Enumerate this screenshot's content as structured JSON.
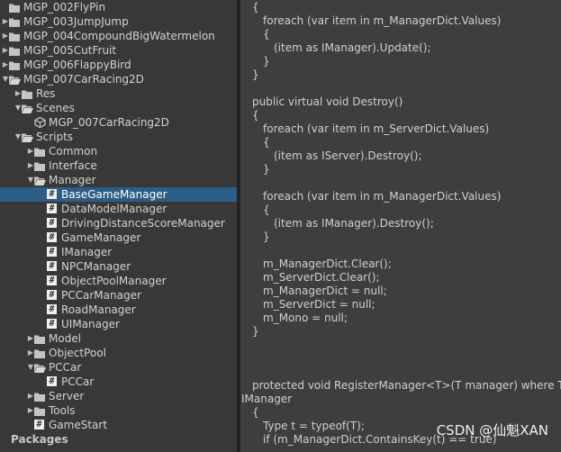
{
  "project_tree": {
    "items": [
      {
        "label": "MGP_002FlyPin",
        "depth": 0,
        "icon": "folder-icon",
        "expander": "none",
        "selected": false
      },
      {
        "label": "MGP_003JumpJump",
        "depth": 0,
        "icon": "folder-icon",
        "expander": "collapsed",
        "selected": false
      },
      {
        "label": "MGP_004CompoundBigWatermelon",
        "depth": 0,
        "icon": "folder-icon",
        "expander": "collapsed",
        "selected": false
      },
      {
        "label": "MGP_005CutFruit",
        "depth": 0,
        "icon": "folder-icon",
        "expander": "collapsed",
        "selected": false
      },
      {
        "label": "MGP_006FlappyBird",
        "depth": 0,
        "icon": "folder-icon",
        "expander": "collapsed",
        "selected": false
      },
      {
        "label": "MGP_007CarRacing2D",
        "depth": 0,
        "icon": "folder-open-icon",
        "expander": "expanded",
        "selected": false
      },
      {
        "label": "Res",
        "depth": 1,
        "icon": "folder-icon",
        "expander": "collapsed",
        "selected": false
      },
      {
        "label": "Scenes",
        "depth": 1,
        "icon": "folder-open-icon",
        "expander": "expanded",
        "selected": false
      },
      {
        "label": "MGP_007CarRacing2D",
        "depth": 2,
        "icon": "scene-icon",
        "expander": "none",
        "selected": false
      },
      {
        "label": "Scripts",
        "depth": 1,
        "icon": "folder-open-icon",
        "expander": "expanded",
        "selected": false
      },
      {
        "label": "Common",
        "depth": 2,
        "icon": "folder-icon",
        "expander": "collapsed",
        "selected": false
      },
      {
        "label": "Interface",
        "depth": 2,
        "icon": "folder-icon",
        "expander": "collapsed",
        "selected": false
      },
      {
        "label": "Manager",
        "depth": 2,
        "icon": "folder-open-icon",
        "expander": "expanded",
        "selected": false
      },
      {
        "label": "BaseGameManager",
        "depth": 3,
        "icon": "script-icon",
        "expander": "none",
        "selected": true
      },
      {
        "label": "DataModelManager",
        "depth": 3,
        "icon": "script-icon",
        "expander": "none",
        "selected": false
      },
      {
        "label": "DrivingDistanceScoreManager",
        "depth": 3,
        "icon": "script-icon",
        "expander": "none",
        "selected": false
      },
      {
        "label": "GameManager",
        "depth": 3,
        "icon": "script-icon",
        "expander": "none",
        "selected": false
      },
      {
        "label": "IManager",
        "depth": 3,
        "icon": "script-icon",
        "expander": "none",
        "selected": false
      },
      {
        "label": "NPCManager",
        "depth": 3,
        "icon": "script-icon",
        "expander": "none",
        "selected": false
      },
      {
        "label": "ObjectPoolManager",
        "depth": 3,
        "icon": "script-icon",
        "expander": "none",
        "selected": false
      },
      {
        "label": "PCCarManager",
        "depth": 3,
        "icon": "script-icon",
        "expander": "none",
        "selected": false
      },
      {
        "label": "RoadManager",
        "depth": 3,
        "icon": "script-icon",
        "expander": "none",
        "selected": false
      },
      {
        "label": "UIManager",
        "depth": 3,
        "icon": "script-icon",
        "expander": "none",
        "selected": false
      },
      {
        "label": "Model",
        "depth": 2,
        "icon": "folder-icon",
        "expander": "collapsed",
        "selected": false
      },
      {
        "label": "ObjectPool",
        "depth": 2,
        "icon": "folder-icon",
        "expander": "collapsed",
        "selected": false
      },
      {
        "label": "PCCar",
        "depth": 2,
        "icon": "folder-open-icon",
        "expander": "expanded",
        "selected": false
      },
      {
        "label": "PCCar",
        "depth": 3,
        "icon": "script-icon",
        "expander": "none",
        "selected": false
      },
      {
        "label": "Server",
        "depth": 2,
        "icon": "folder-icon",
        "expander": "collapsed",
        "selected": false
      },
      {
        "label": "Tools",
        "depth": 2,
        "icon": "folder-icon",
        "expander": "collapsed",
        "selected": false
      },
      {
        "label": "GameStart",
        "depth": 2,
        "icon": "script-icon",
        "expander": "none",
        "selected": false
      },
      {
        "label": "Packages",
        "depth": -1,
        "icon": "none",
        "expander": "none",
        "selected": false
      }
    ]
  },
  "script_icon_glyph": "#",
  "code_lines": [
    {
      "text": "{",
      "indent": 1
    },
    {
      "text": "foreach (var item in m_ManagerDict.Values)",
      "indent": 2
    },
    {
      "text": "{",
      "indent": 2
    },
    {
      "text": "(item as IManager).Update();",
      "indent": 3
    },
    {
      "text": "}",
      "indent": 2
    },
    {
      "text": "}",
      "indent": 1
    },
    {
      "text": "",
      "indent": 0
    },
    {
      "text": "public virtual void Destroy()",
      "indent": 1
    },
    {
      "text": "{",
      "indent": 1
    },
    {
      "text": "foreach (var item in m_ServerDict.Values)",
      "indent": 2
    },
    {
      "text": "{",
      "indent": 2
    },
    {
      "text": "(item as IServer).Destroy();",
      "indent": 3
    },
    {
      "text": "}",
      "indent": 2
    },
    {
      "text": "",
      "indent": 0
    },
    {
      "text": "foreach (var item in m_ManagerDict.Values)",
      "indent": 2
    },
    {
      "text": "{",
      "indent": 2
    },
    {
      "text": "(item as IManager).Destroy();",
      "indent": 3
    },
    {
      "text": "}",
      "indent": 2
    },
    {
      "text": "",
      "indent": 0
    },
    {
      "text": "m_ManagerDict.Clear();",
      "indent": 2
    },
    {
      "text": "m_ServerDict.Clear();",
      "indent": 2
    },
    {
      "text": "m_ManagerDict = null;",
      "indent": 2
    },
    {
      "text": "m_ServerDict = null;",
      "indent": 2
    },
    {
      "text": "m_Mono = null;",
      "indent": 2
    },
    {
      "text": "}",
      "indent": 1
    },
    {
      "text": "",
      "indent": 0
    },
    {
      "text": "",
      "indent": 0
    },
    {
      "text": "",
      "indent": 0
    },
    {
      "text": "protected void RegisterManager<T>(T manager) where T :",
      "indent": 1
    },
    {
      "text": "IManager",
      "indent": 0
    },
    {
      "text": "{",
      "indent": 1
    },
    {
      "text": "Type t = typeof(T);",
      "indent": 2
    },
    {
      "text": "if (m_ManagerDict.ContainsKey(t) == true)",
      "indent": 2
    }
  ],
  "watermark": "CSDN @仙魁XAN",
  "colors": {
    "selection": "#2c5d87",
    "tree_bg": "#383838",
    "code_bg": "#3e3e3e",
    "folder": "#c4c4c4"
  }
}
